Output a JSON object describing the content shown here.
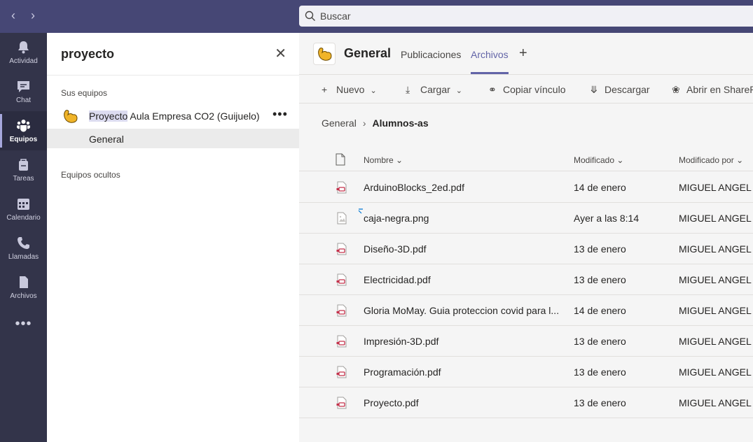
{
  "search": {
    "placeholder": "Buscar"
  },
  "rail": {
    "items": [
      {
        "label": "Actividad",
        "icon": "bell-icon"
      },
      {
        "label": "Chat",
        "icon": "chat-icon"
      },
      {
        "label": "Equipos",
        "icon": "teams-icon",
        "active": true
      },
      {
        "label": "Tareas",
        "icon": "tasks-icon"
      },
      {
        "label": "Calendario",
        "icon": "calendar-icon"
      },
      {
        "label": "Llamadas",
        "icon": "phone-icon"
      },
      {
        "label": "Archivos",
        "icon": "file-icon"
      }
    ],
    "more": "•••"
  },
  "panel": {
    "title": "proyecto",
    "your_teams_label": "Sus equipos",
    "team": {
      "name_highlight": "Proyecto",
      "name_rest": " Aula Empresa CO2 (Guijuelo)",
      "more": "•••"
    },
    "channel": "General",
    "hidden_teams_label": "Equipos ocultos"
  },
  "main": {
    "channel_title": "General",
    "tabs": {
      "posts": "Publicaciones",
      "files": "Archivos",
      "add": "+"
    },
    "toolbar": {
      "new": "Nuevo",
      "upload": "Cargar",
      "copy_link": "Copiar vínculo",
      "download": "Descargar",
      "open_sharepoint": "Abrir en SharePoint"
    },
    "breadcrumb": {
      "root": "General",
      "current": "Alumnos-as"
    },
    "columns": {
      "name": "Nombre",
      "modified": "Modificado",
      "modified_by": "Modificado por"
    },
    "files": [
      {
        "name": "ArduinoBlocks_2ed.pdf",
        "modified": "14 de enero",
        "by": "MIGUEL ANGEL C",
        "type": "pdf"
      },
      {
        "name": "caja-negra.png",
        "modified": "Ayer a las 8:14",
        "by": "MIGUEL ANGEL C",
        "type": "image"
      },
      {
        "name": "Diseño-3D.pdf",
        "modified": "13 de enero",
        "by": "MIGUEL ANGEL C",
        "type": "pdf"
      },
      {
        "name": "Electricidad.pdf",
        "modified": "13 de enero",
        "by": "MIGUEL ANGEL C",
        "type": "pdf"
      },
      {
        "name": "Gloria MoMay. Guia proteccion covid para l...",
        "modified": "14 de enero",
        "by": "MIGUEL ANGEL C",
        "type": "pdf"
      },
      {
        "name": "Impresión-3D.pdf",
        "modified": "13 de enero",
        "by": "MIGUEL ANGEL C",
        "type": "pdf"
      },
      {
        "name": "Programación.pdf",
        "modified": "13 de enero",
        "by": "MIGUEL ANGEL C",
        "type": "pdf"
      },
      {
        "name": "Proyecto.pdf",
        "modified": "13 de enero",
        "by": "MIGUEL ANGEL C",
        "type": "pdf"
      }
    ]
  },
  "colors": {
    "accent": "#6264a7",
    "topbar": "#464775",
    "rail": "#33344a",
    "pdf": "#c4314b"
  }
}
